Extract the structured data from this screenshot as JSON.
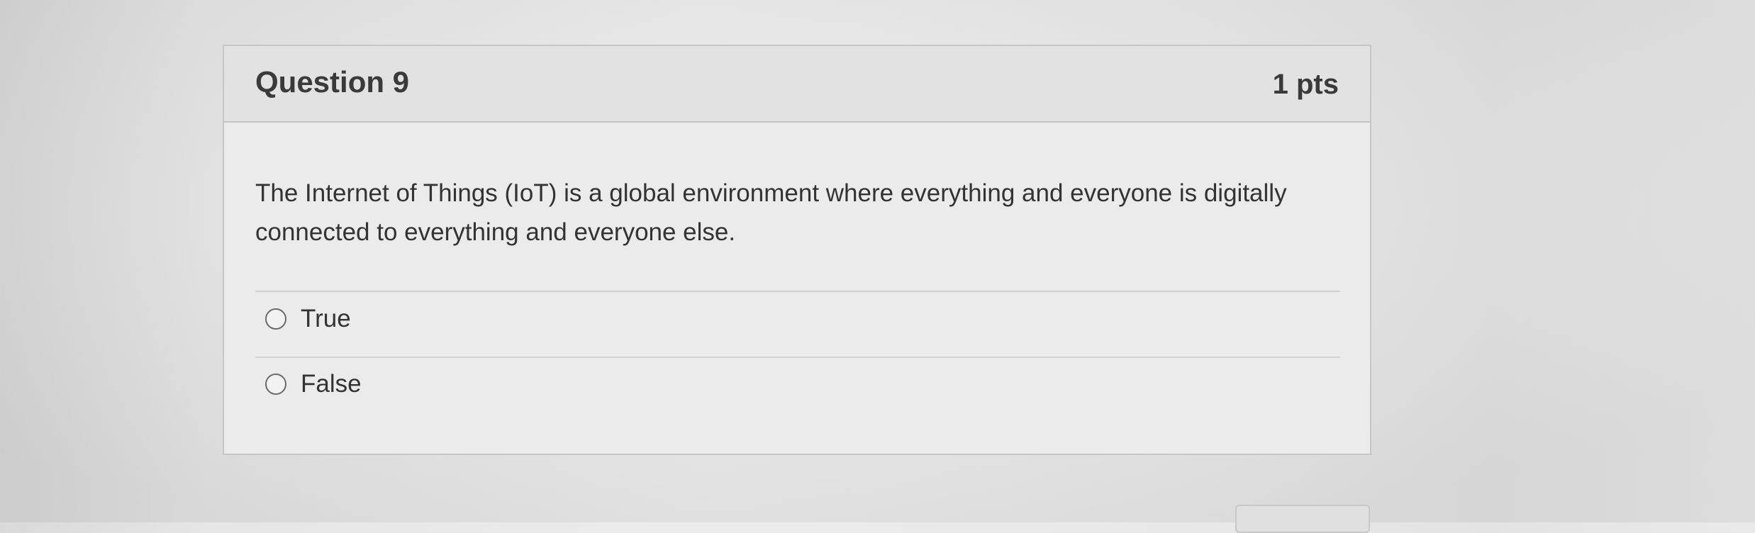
{
  "question": {
    "title": "Question 9",
    "points": "1 pts",
    "text": "The Internet of Things (IoT) is a global environment where everything and everyone is digitally connected to everything and everyone else.",
    "answers": [
      {
        "label": "True",
        "selected": false
      },
      {
        "label": "False",
        "selected": false
      }
    ]
  },
  "icons": {
    "radio": "radio-circle-icon"
  }
}
